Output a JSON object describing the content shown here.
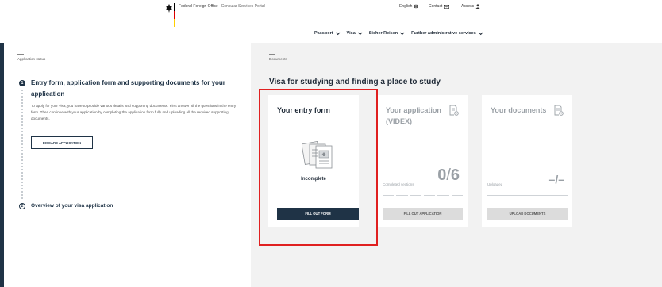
{
  "header": {
    "office_name": "Federal Foreign Office",
    "portal_name": "Consular Services Portal",
    "language": "English",
    "contact": "Contact",
    "access": "Access",
    "nav": [
      "Passport",
      "Visa",
      "Sicher Reisen",
      "Further administrative services"
    ]
  },
  "left": {
    "label": "Application status",
    "step1_number": "1",
    "step1_title_line1": "Entry form, application form and supporting documents for your",
    "step1_title_line2": "application",
    "step1_desc": "To apply for your visa, you have to provide various details and supporting documents. First answer all the questions in the entry form. Then continue with your application by completing the application form fully and uploading all the required supporting documents.",
    "discard_label": "DISCARD APPLICATION",
    "step2_number": "2",
    "step2_title": "Overview of your visa application"
  },
  "right": {
    "label": "Documents",
    "title": "Visa for studying and finding a place to study",
    "cards": {
      "entry": {
        "title": "Your entry form",
        "status": "Incomplete",
        "button": "FILL OUT FORM"
      },
      "application": {
        "title_line1": "Your application",
        "title_line2": "(VIDEX)",
        "meta_label": "Completed sections",
        "progress_done": "0",
        "progress_total": "6",
        "button": "FILL OUT APPLICATION"
      },
      "documents": {
        "title": "Your documents",
        "meta_label": "Uploaded",
        "value": "–/–",
        "button": "UPLOAD DOCUMENTS"
      }
    }
  },
  "colors": {
    "primary": "#1f3346",
    "highlight": "#e02020",
    "panel_bg": "#f2f2f2"
  },
  "icons": [
    "eagle-icon",
    "globe-icon",
    "mail-icon",
    "user-icon",
    "chevron-down-icon",
    "form-illustration-icon",
    "document-gear-icon",
    "document-clock-icon"
  ]
}
